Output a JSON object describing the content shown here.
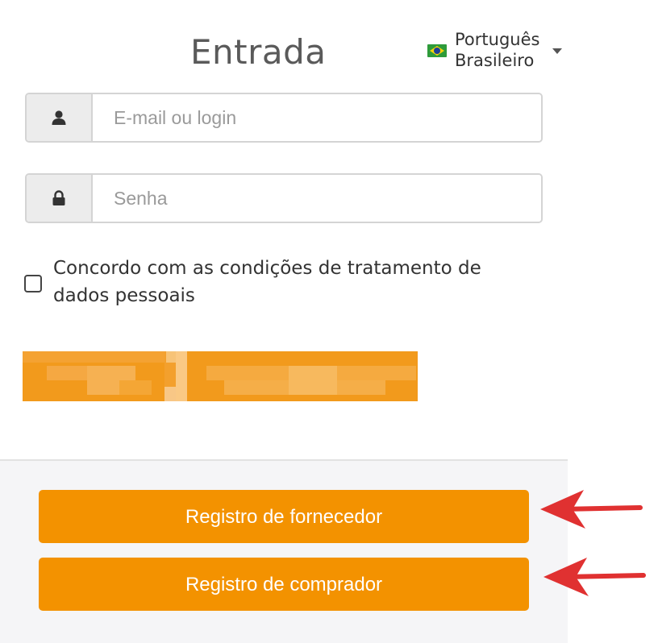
{
  "header": {
    "title": "Entrada",
    "language": {
      "line1": "Português",
      "line2": "Brasileiro",
      "flag_icon": "brazil-flag-icon"
    }
  },
  "form": {
    "login": {
      "placeholder": "E-mail ou login",
      "value": "",
      "icon": "user-icon"
    },
    "password": {
      "placeholder": "Senha",
      "value": "",
      "icon": "lock-icon"
    },
    "consent": {
      "label": "Concordo com as condições de tratamento de dados pessoais",
      "checked": false
    },
    "submit": {
      "redacted": true
    }
  },
  "footer": {
    "supplier_button": "Registro de fornecedor",
    "buyer_button": "Registro de comprador"
  },
  "colors": {
    "accent": "#f39200",
    "annotation_arrow": "#e03131"
  }
}
